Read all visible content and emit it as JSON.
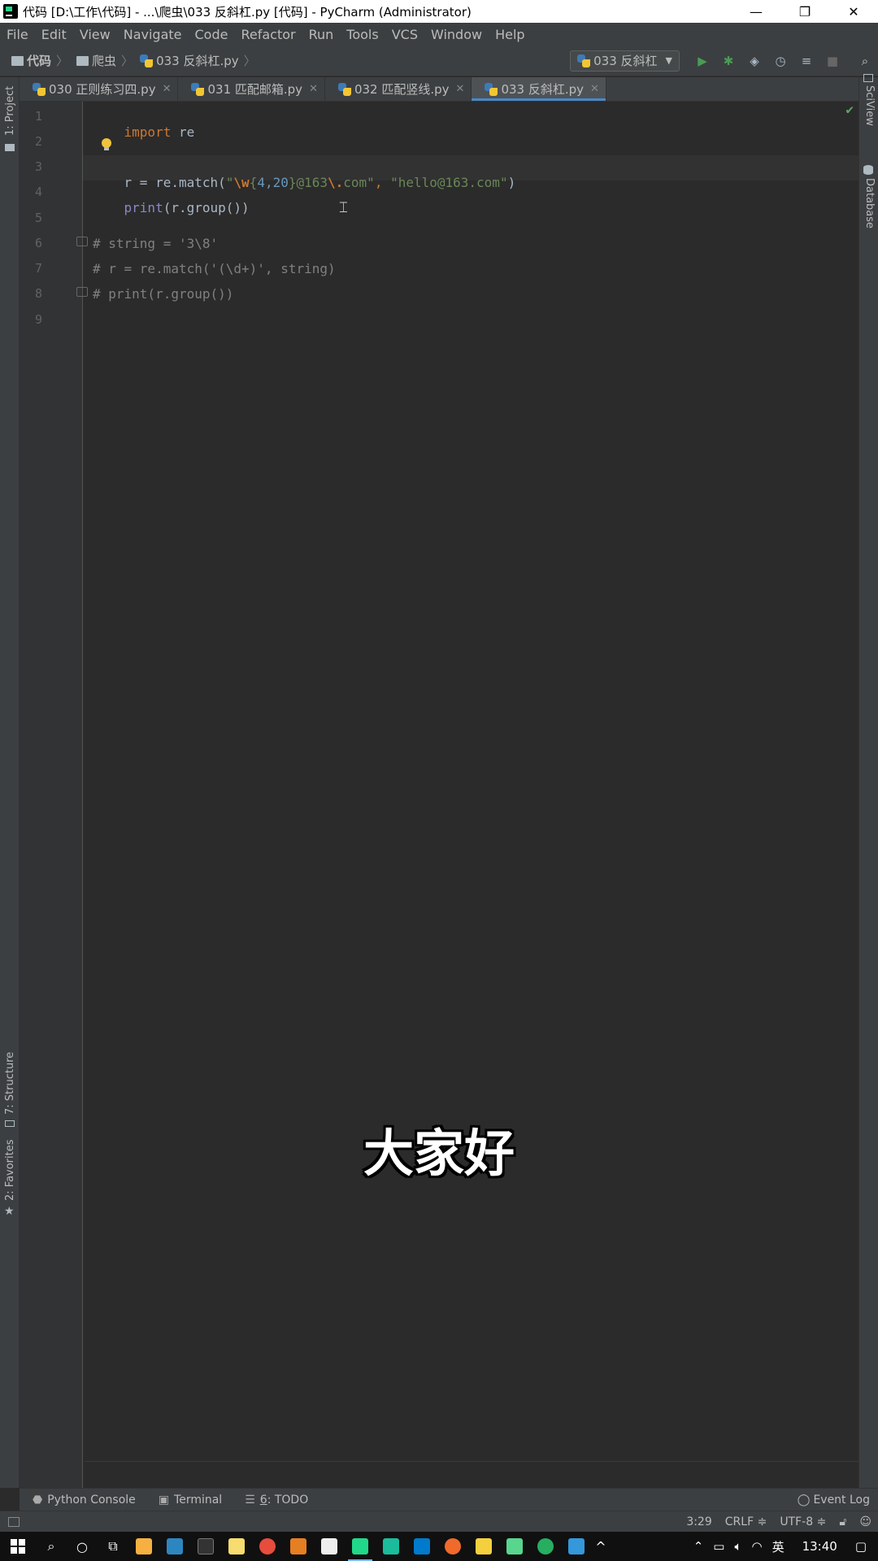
{
  "window": {
    "title": "代码 [D:\\工作\\代码] - ...\\爬虫\\033 反斜杠.py [代码] - PyCharm (Administrator)",
    "minimize": "—",
    "restore": "❐",
    "close": "✕"
  },
  "menu": [
    "File",
    "Edit",
    "View",
    "Navigate",
    "Code",
    "Refactor",
    "Run",
    "Tools",
    "VCS",
    "Window",
    "Help"
  ],
  "breadcrumb": {
    "root": "代码",
    "folder": "爬虫",
    "file": "033 反斜杠.py"
  },
  "run_config": {
    "label": "033 反斜杠"
  },
  "tabs": [
    {
      "label": "030 正则练习四.py",
      "active": false
    },
    {
      "label": "031 匹配邮箱.py",
      "active": false
    },
    {
      "label": "032 匹配竖线.py",
      "active": false
    },
    {
      "label": "033 反斜杠.py",
      "active": true
    }
  ],
  "side_tabs": {
    "project": "1: Project",
    "structure": "7: Structure",
    "favorites": "2: Favorites",
    "sciview": "SciView",
    "database": "Database"
  },
  "code": {
    "line_numbers": [
      "1",
      "2",
      "3",
      "4",
      "5",
      "6",
      "7",
      "8",
      "9"
    ],
    "l1_kw": "import",
    "l1_rest": " re",
    "l3_a": "r = re.match(",
    "l3_q1": "\"",
    "l3_esc1": "\\w",
    "l3_brace1": "{",
    "l3_num1": "4,20",
    "l3_brace2": "}",
    "l3_mid": "@163",
    "l3_esc2": "\\.",
    "l3_tail": "com\"",
    "l3_comma": ", ",
    "l3_str2": "\"hello@163.com\"",
    "l3_close": ")",
    "l4_bi": "print",
    "l4_rest": "(r.group())",
    "l6": "# string = '3\\8'",
    "l7": "# r = re.match('(\\d+)', string)",
    "l8": "# print(r.group())"
  },
  "subtitle": "大家好",
  "tool_windows": {
    "python_console": "Python Console",
    "terminal": "Terminal",
    "todo_num": "6",
    "todo_label": ": TODO",
    "event_log": "Event Log"
  },
  "status": {
    "position": "3:29",
    "line_sep": "CRLF ≑",
    "encoding": "UTF-8 ≑"
  },
  "taskbar": {
    "ime": "英",
    "time": "13:40"
  }
}
